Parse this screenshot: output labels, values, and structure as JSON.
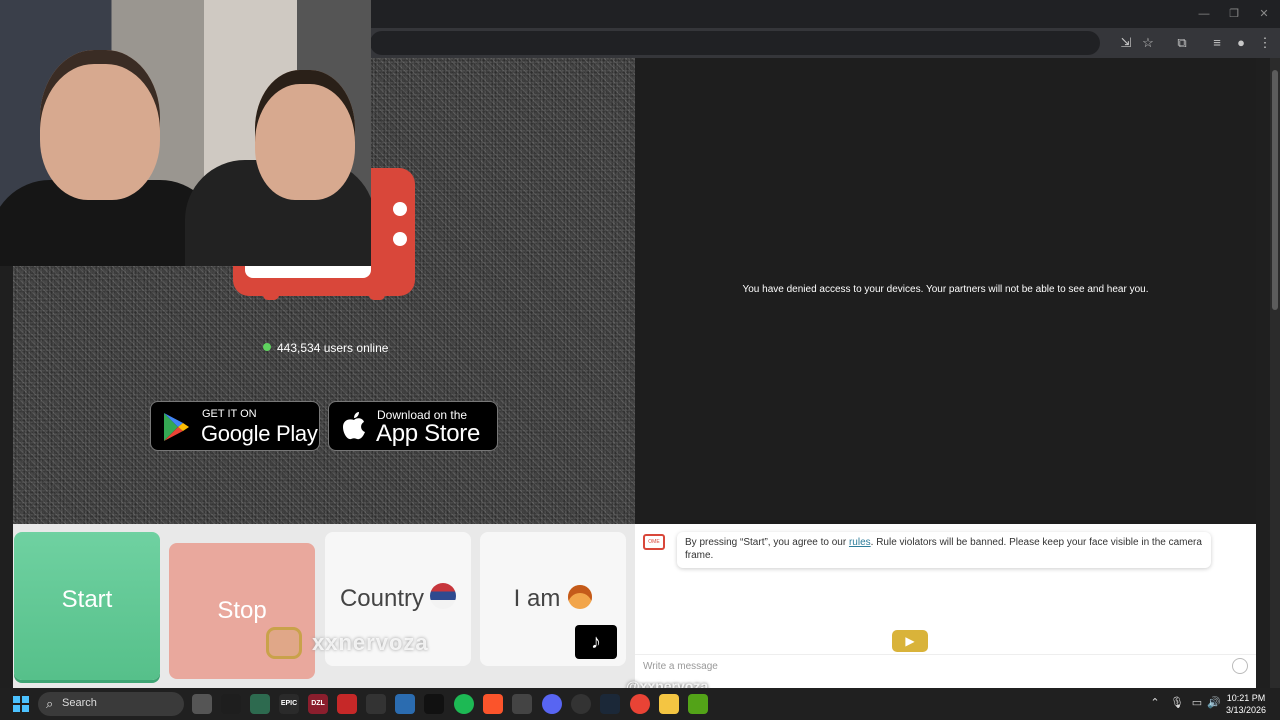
{
  "window": {
    "minimize_glyph": "—",
    "restore_glyph": "❐",
    "close_glyph": "✕"
  },
  "toolbar": {
    "icons": [
      "install-icon",
      "bookmark-star-icon",
      "extensions-icon",
      "tab-search-icon",
      "profile-avatar-icon",
      "menu-kebab-icon"
    ]
  },
  "video": {
    "denied_message": "You have denied access to your devices. Your partners will not be able to see and hear you.",
    "online_count": "443,534 users online",
    "status_color": "#5fd35f"
  },
  "stores": {
    "google": {
      "small": "GET IT ON",
      "big": "Google Play"
    },
    "apple": {
      "small": "Download on the",
      "big": "App Store"
    }
  },
  "controls": {
    "start_label": "Start",
    "stop_label": "Stop",
    "country_label": "Country",
    "iam_label": "I am",
    "start_color": "#6fd1a1",
    "stop_color": "#e9a89d"
  },
  "chat": {
    "system_pre": "By pressing “Start”, you agree to our ",
    "system_link": "rules",
    "system_post": ". Rule violators will be banned. Please keep your face visible in the camera frame.",
    "placeholder": "Write a message",
    "brand_color": "#d9473a"
  },
  "overlay": {
    "instagram_handle": "xxnervoza",
    "tiktok_handle": "@xxnervoza"
  },
  "taskbar": {
    "search_label": "Search",
    "time": "10:21 PM",
    "date": "3/13/2026",
    "apps": [
      {
        "name": "epic-games-app",
        "label": "EPIC",
        "color": "#2a2a2a"
      },
      {
        "name": "dzl-app",
        "label": "DZL",
        "color": "#8b1e2d"
      },
      {
        "name": "spotify-app",
        "label": "",
        "color": "#1db954"
      },
      {
        "name": "brave-app",
        "label": "",
        "color": "#fb542b"
      },
      {
        "name": "discord-app",
        "label": "",
        "color": "#5865f2"
      },
      {
        "name": "steam-app",
        "label": "",
        "color": "#1b2838"
      },
      {
        "name": "chrome-app",
        "label": "",
        "color": "#e94335"
      },
      {
        "name": "file-explorer-app",
        "label": "",
        "color": "#f4c542"
      }
    ]
  }
}
